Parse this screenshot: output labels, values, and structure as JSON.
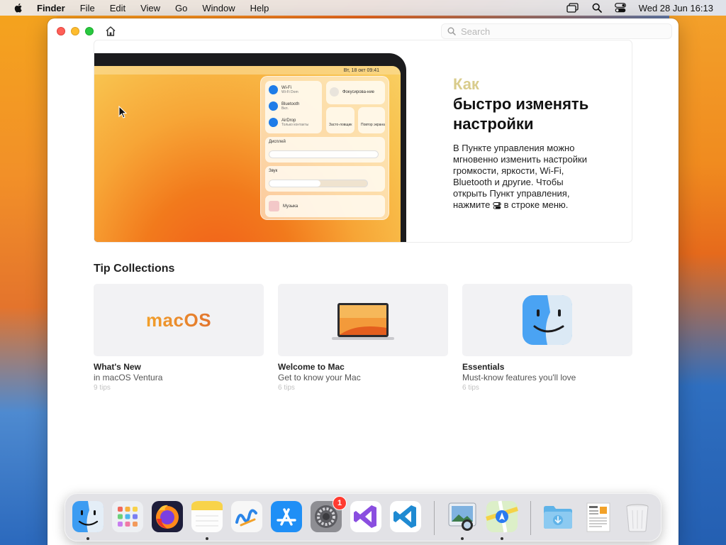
{
  "menubar": {
    "app_name": "Finder",
    "items": [
      "File",
      "Edit",
      "View",
      "Go",
      "Window",
      "Help"
    ],
    "clock": "Wed 28 Jun  16:13"
  },
  "window": {
    "search_placeholder": "Search"
  },
  "hero": {
    "kicker": "Как",
    "title_line1": "быстро изменять",
    "title_line2": "настройки",
    "body_line1": "В Пункте управления можно",
    "body_line2": "мгновенно изменить настройки",
    "body_line3": "громкости, яркости, Wi-Fi,",
    "body_line4": "Bluetooth и другие. Чтобы",
    "body_line5": "открыть Пункт управления,",
    "body_line6_pre": "нажмите",
    "body_line6_post": "в строке меню.",
    "screen": {
      "clock": "Вт, 18 окт  09:41",
      "wifi_label": "Wi-Fi",
      "wifi_sub": "Wi-Fi Dom",
      "bluetooth_label": "Bluetooth",
      "bluetooth_sub": "Вкл.",
      "airdrop_label": "AirDrop",
      "airdrop_sub": "Только контакты",
      "focus_label": "Фокусирова-ние",
      "mirror_label": "Повтор экрана",
      "stage_label": "Засто-ловщик",
      "display_label": "Дисплей",
      "sound_label": "Звук",
      "music_label": "Музыка"
    }
  },
  "collections": {
    "title": "Tip Collections",
    "tiles": [
      {
        "name": "What's New",
        "subtitle": "in macOS Ventura",
        "count": "9 tips",
        "logo_text": "macOS"
      },
      {
        "name": "Welcome to Mac",
        "subtitle": "Get to know your Mac",
        "count": "6 tips"
      },
      {
        "name": "Essentials",
        "subtitle": "Must-know features you'll love",
        "count": "6 tips"
      }
    ]
  },
  "dock": {
    "apps": [
      "finder",
      "launchpad",
      "firefox",
      "notes",
      "freeform",
      "app-store",
      "system-settings",
      "visual-studio",
      "vscode",
      "preview",
      "maps",
      "downloads",
      "document",
      "trash"
    ],
    "settings_badge": "1"
  },
  "colors": {
    "accent_blue": "#1e7ce8",
    "kicker": "#d9cc8c",
    "badge_red": "#ff3b30"
  }
}
